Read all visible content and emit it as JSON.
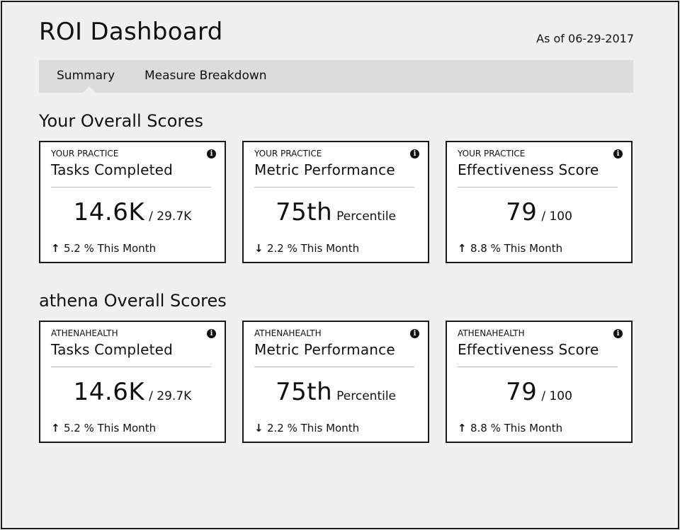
{
  "header": {
    "title": "ROI Dashboard",
    "date": "As of 06-29-2017"
  },
  "tabs": [
    {
      "label": "Summary",
      "selected": true
    },
    {
      "label": "Measure Breakdown",
      "selected": false
    }
  ],
  "sections": [
    {
      "heading": "Your Overall Scores",
      "cards": [
        {
          "label": "YOUR PRACTICE",
          "title": "Tasks Completed",
          "value": "14.6K",
          "sub": "/ 29.7K",
          "trend_direction": "up",
          "trend_arrow": "↑",
          "trend": "5.2 % This Month",
          "info_icon": "info-icon"
        },
        {
          "label": "YOUR PRACTICE",
          "title": "Metric Performance",
          "value": "75th",
          "sub": "Percentile",
          "trend_direction": "down",
          "trend_arrow": "↓",
          "trend": "2.2 % This Month",
          "info_icon": "info-icon"
        },
        {
          "label": "YOUR PRACTICE",
          "title": "Effectiveness Score",
          "value": "79",
          "sub": "/ 100",
          "trend_direction": "up",
          "trend_arrow": "↑",
          "trend": "8.8 % This Month",
          "info_icon": "info-icon"
        }
      ]
    },
    {
      "heading": "athena Overall Scores",
      "cards": [
        {
          "label": "ATHENAHEALTH",
          "title": "Tasks Completed",
          "value": "14.6K",
          "sub": "/ 29.7K",
          "trend_direction": "up",
          "trend_arrow": "↑",
          "trend": "5.2 % This Month",
          "info_icon": "info-icon"
        },
        {
          "label": "ATHENAHEALTH",
          "title": "Metric Performance",
          "value": "75th",
          "sub": "Percentile",
          "trend_direction": "down",
          "trend_arrow": "↓",
          "trend": "2.2 % This Month",
          "info_icon": "info-icon"
        },
        {
          "label": "ATHENAHEALTH",
          "title": "Effectiveness Score",
          "value": "79",
          "sub": "/ 100",
          "trend_direction": "up",
          "trend_arrow": "↑",
          "trend": "8.8 % This Month",
          "info_icon": "info-icon"
        }
      ]
    }
  ],
  "colors": {
    "background": "#f0f0f0",
    "tabbar": "#dcdcdc",
    "card": "#ffffff",
    "border": "#1a1a1a"
  }
}
